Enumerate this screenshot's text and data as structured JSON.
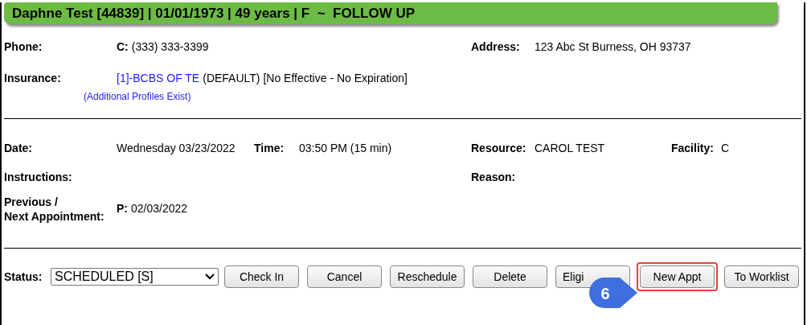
{
  "header": {
    "title": "Daphne Test [44839] | 01/01/1973 | 49 years | F  ~  FOLLOW UP"
  },
  "patient": {
    "phone": {
      "label": "Phone:",
      "prefix": "C:",
      "value": "(333) 333-3399"
    },
    "address": {
      "label": "Address:",
      "value": "123 Abc St Burness, OH 93737"
    },
    "insurance": {
      "label": "Insurance:",
      "link": "[1]-BCBS OF TE",
      "detail": "(DEFAULT) [No Effective - No Expiration]",
      "more_link": "(Additional Profiles Exist)"
    }
  },
  "appointment": {
    "date": {
      "label": "Date:",
      "value": "Wednesday 03/23/2022"
    },
    "time": {
      "label": "Time:",
      "value": "03:50 PM (15 min)"
    },
    "resource": {
      "label": "Resource:",
      "value": "CAROL TEST"
    },
    "facility": {
      "label": "Facility:",
      "value": "C"
    },
    "instructions": {
      "label": "Instructions:"
    },
    "reason": {
      "label": "Reason:"
    },
    "previous_next": {
      "label_lines": [
        "Previous /",
        "Next Appointment:"
      ],
      "prefix": "P:",
      "value": "02/03/2022"
    }
  },
  "status_bar": {
    "label": "Status:",
    "select": {
      "value": "SCHEDULED [S]"
    },
    "buttons": [
      {
        "label": "Check In",
        "highlighted": false
      },
      {
        "label": "Cancel",
        "highlighted": false
      },
      {
        "label": "Reschedule",
        "highlighted": false
      },
      {
        "label": "Delete",
        "highlighted": false
      },
      {
        "label": "Eligi",
        "highlighted": false
      },
      {
        "label": "New Appt",
        "highlighted": true
      },
      {
        "label": "To Worklist",
        "highlighted": false
      }
    ],
    "callout": {
      "number": "6"
    }
  }
}
